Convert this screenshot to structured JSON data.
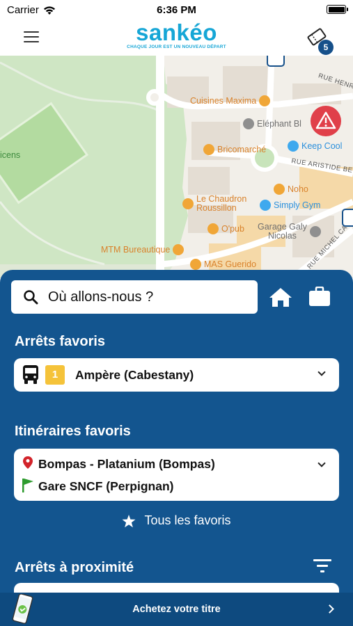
{
  "status_bar": {
    "carrier": "Carrier",
    "time": "6:36 PM"
  },
  "header": {
    "logo_name": "sankéo",
    "logo_tagline": "CHAQUE JOUR EST UN NOUVEAU DÉPART",
    "tickets_count": "5"
  },
  "map": {
    "pois": [
      {
        "name": "Cuisines Maxima",
        "kind": "orange"
      },
      {
        "name": "Eléphant Bl",
        "kind": "gray"
      },
      {
        "name": "Bricomarché",
        "kind": "orange"
      },
      {
        "name": "Keep Cool",
        "kind": "blue"
      },
      {
        "name": "Noho",
        "kind": "orange"
      },
      {
        "name": "Le Chaudron\nRoussillon",
        "kind": "orange"
      },
      {
        "name": "Simply Gym",
        "kind": "blue"
      },
      {
        "name": "O'pub",
        "kind": "orange"
      },
      {
        "name": "Garage Galy\nNicolas",
        "kind": "gray"
      },
      {
        "name": "MTM Bureautique",
        "kind": "orange"
      },
      {
        "name": "MAS Guerido",
        "kind": "orange"
      }
    ],
    "streets": [
      "RUE HENRI",
      "RUE ARISTIDE BE",
      "RUE MICHEL CA"
    ],
    "park_label": "icens"
  },
  "search": {
    "placeholder": "Où allons-nous ?"
  },
  "favorite_stops": {
    "title": "Arrêts favoris",
    "items": [
      {
        "line": "1",
        "name": "Ampère (Cabestany)"
      }
    ]
  },
  "favorite_itineraries": {
    "title": "Itinéraires favoris",
    "items": [
      {
        "from": "Bompas - Platanium (Bompas)",
        "to": "Gare SNCF (Perpignan)"
      }
    ]
  },
  "all_favorites": "Tous les favoris",
  "nearby": {
    "title": "Arrêts à proximité"
  },
  "footer": {
    "label": "Achetez votre titre"
  },
  "colors": {
    "brand": "#16a6d6",
    "panel": "#13558f",
    "line_1": "#f5c33a",
    "alert": "#e0404a"
  },
  "icons": [
    "wifi-icon",
    "battery-icon",
    "menu-icon",
    "ticket-icon",
    "search-icon",
    "home-icon",
    "briefcase-icon",
    "bus-icon",
    "location-pin-icon",
    "flag-icon",
    "star-icon",
    "filter-icon",
    "phone-ticket-icon",
    "chevron-right-icon",
    "warning-icon"
  ]
}
